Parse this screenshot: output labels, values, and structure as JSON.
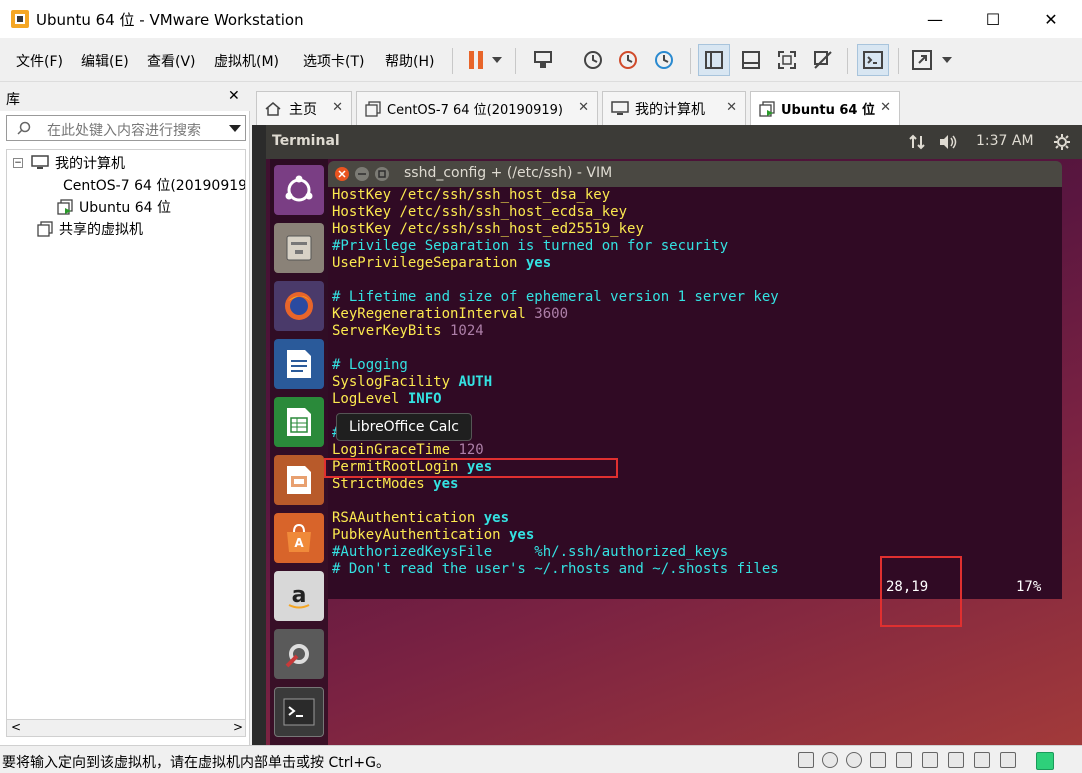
{
  "window": {
    "title": "Ubuntu 64 位 - VMware Workstation",
    "minimize": "—",
    "maximize": "☐",
    "close": "✕"
  },
  "menu": [
    "文件(F)",
    "编辑(E)",
    "查看(V)",
    "虚拟机(M)",
    "选项卡(T)",
    "帮助(H)"
  ],
  "library": {
    "title": "库",
    "close": "✕",
    "search_placeholder": "在此处键入内容进行搜索",
    "tree": {
      "my_computer": "我的计算机",
      "vm1": "CentOS-7 64 位(20190919)",
      "vm2": "Ubuntu 64 位",
      "shared": "共享的虚拟机"
    }
  },
  "tabs": [
    {
      "label": "主页"
    },
    {
      "label": "CentOS-7 64 位(20190919)"
    },
    {
      "label": "我的计算机"
    },
    {
      "label": "Ubuntu 64 位"
    }
  ],
  "ubuntu": {
    "app_name": "Terminal",
    "time": "1:37 AM",
    "window_title": "sshd_config + (/etc/ssh) - VIM",
    "tooltip": "LibreOffice Calc",
    "launcher_icons": [
      "ubuntu-dash-icon",
      "files-icon",
      "firefox-icon",
      "writer-icon",
      "calc-icon",
      "impress-icon",
      "software-center-icon",
      "amazon-icon",
      "system-settings-icon",
      "terminal-icon"
    ]
  },
  "vim": {
    "lines": [
      {
        "k": "HostKey",
        "v": " /etc/ssh/ssh_host_dsa_key",
        "t": "kv"
      },
      {
        "k": "HostKey",
        "v": " /etc/ssh/ssh_host_ecdsa_key",
        "t": "kv"
      },
      {
        "k": "HostKey",
        "v": " /etc/ssh/ssh_host_ed25519_key",
        "t": "kv"
      },
      {
        "k": "#Privilege Separation is turned on for security",
        "v": "",
        "t": "com"
      },
      {
        "k": "UsePrivilegeSeparation",
        "v": " yes",
        "t": "kb"
      },
      {
        "k": "",
        "v": "",
        "t": "blank"
      },
      {
        "k": "# Lifetime and size of ephemeral version 1 server key",
        "v": "",
        "t": "com"
      },
      {
        "k": "KeyRegenerationInterval",
        "v": " 3600",
        "t": "kn"
      },
      {
        "k": "ServerKeyBits",
        "v": " 1024",
        "t": "kn"
      },
      {
        "k": "",
        "v": "",
        "t": "blank"
      },
      {
        "k": "# Logging",
        "v": "",
        "t": "com"
      },
      {
        "k": "SyslogFacility",
        "v": " AUTH",
        "t": "kb"
      },
      {
        "k": "LogLevel",
        "v": " INFO",
        "t": "kb"
      },
      {
        "k": "",
        "v": "",
        "t": "blank"
      },
      {
        "k": "# Authentication:",
        "v": "",
        "t": "com"
      },
      {
        "k": "LoginGraceTime",
        "v": " 120",
        "t": "kn"
      },
      {
        "k": "PermitRootLogin",
        "v": " yes",
        "t": "kb"
      },
      {
        "k": "StrictModes",
        "v": " yes",
        "t": "kb"
      },
      {
        "k": "",
        "v": "",
        "t": "blank"
      },
      {
        "k": "RSAAuthentication",
        "v": " yes",
        "t": "kb"
      },
      {
        "k": "PubkeyAuthentication",
        "v": " yes",
        "t": "kb"
      },
      {
        "k": "#AuthorizedKeysFile     %h/.ssh/authorized_keys",
        "v": "",
        "t": "com"
      },
      {
        "k": "# Don't read the user's ~/.rhosts and ~/.shosts files",
        "v": "",
        "t": "com"
      }
    ],
    "cursor_pos": "28,19",
    "percent": "17%"
  },
  "statusbar": {
    "message": "要将输入定向到该虚拟机，请在虚拟机内部单击或按 Ctrl+G。"
  }
}
